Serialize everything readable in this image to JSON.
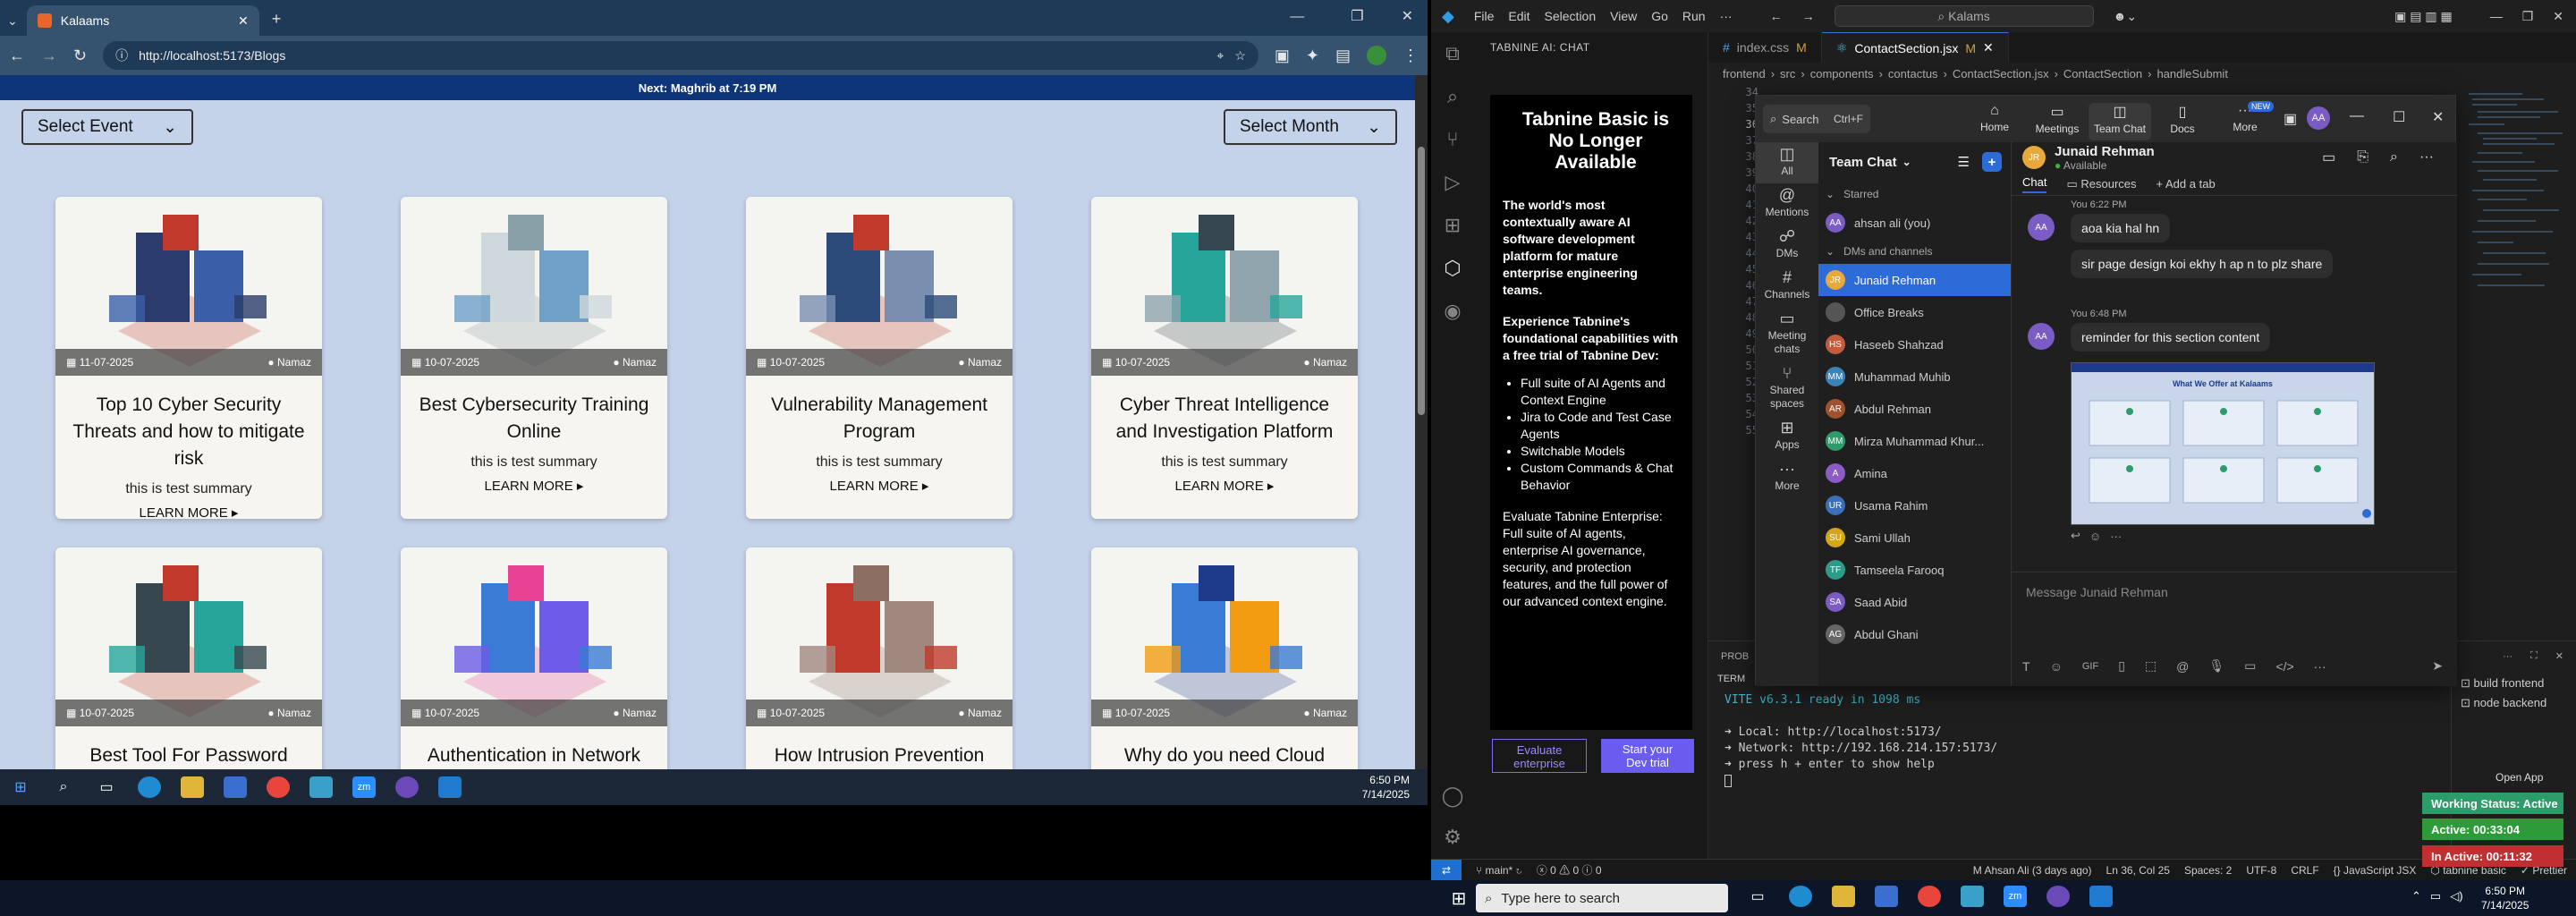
{
  "browser": {
    "tab_title": "Kalaams",
    "url": "http://localhost:5173/Blogs",
    "prayer_banner_prefix": "Next:",
    "prayer_banner": "Maghrib at 7:19 PM",
    "select_event": "Select Event",
    "select_month": "Select Month",
    "cards": [
      {
        "date": "11-07-2025",
        "tag": "Namaz",
        "title": "Top 10 Cyber Security Threats and how to mitigate risk",
        "summary": "this is test summary",
        "more": "LEARN MORE"
      },
      {
        "date": "10-07-2025",
        "tag": "Namaz",
        "title": "Best Cybersecurity Training Online",
        "summary": "this is test summary",
        "more": "LEARN MORE"
      },
      {
        "date": "10-07-2025",
        "tag": "Namaz",
        "title": "Vulnerability Management Program",
        "summary": "this is test summary",
        "more": "LEARN MORE"
      },
      {
        "date": "10-07-2025",
        "tag": "Namaz",
        "title": "Cyber Threat Intelligence and Investigation Platform",
        "summary": "this is test summary",
        "more": "LEARN MORE"
      },
      {
        "date": "10-07-2025",
        "tag": "Namaz",
        "title": "Best Tool For Password",
        "summary": "",
        "more": ""
      },
      {
        "date": "10-07-2025",
        "tag": "Namaz",
        "title": "Authentication in Network",
        "summary": "",
        "more": ""
      },
      {
        "date": "10-07-2025",
        "tag": "Namaz",
        "title": "How Intrusion Prevention",
        "summary": "",
        "more": ""
      },
      {
        "date": "10-07-2025",
        "tag": "Namaz",
        "title": "Why do you need Cloud",
        "summary": "",
        "more": ""
      }
    ],
    "taskbar_time": "6:50 PM",
    "taskbar_date": "7/14/2025"
  },
  "vscode": {
    "menu": [
      "File",
      "Edit",
      "Selection",
      "View",
      "Go",
      "Run",
      "···"
    ],
    "search": "Kalams",
    "tabnine": {
      "header": "TABNINE AI: CHAT",
      "title": "Tabnine Basic is No Longer Available",
      "p1": "The world's most contextually aware AI software development platform for mature enterprise engineering teams.",
      "p2": "Experience Tabnine's foundational capabilities with a free trial of Tabnine Dev:",
      "bullets": [
        "Full suite of AI Agents and Context Engine",
        "Jira to Code and Test Case Agents",
        "Switchable Models",
        "Custom Commands & Chat Behavior"
      ],
      "p3": "Evaluate Tabnine Enterprise: Full suite of AI agents, enterprise AI governance, security, and protection features, and the full power of our advanced context engine.",
      "btn_eval": "Evaluate enterprise",
      "btn_trial": "Start your Dev trial"
    },
    "tabs": [
      {
        "name": "index.css",
        "mark": "M"
      },
      {
        "name": "ContactSection.jsx",
        "mark": "M"
      }
    ],
    "breadcrumb": [
      "frontend",
      "src",
      "components",
      "contactus",
      "ContactSection.jsx",
      "ContactSection",
      "handleSubmit"
    ],
    "line_numbers": [
      "34",
      "35",
      "36",
      "37",
      "38",
      "39",
      "40",
      "41",
      "42",
      "43",
      "44",
      "45",
      "46",
      "47",
      "48",
      "49",
      "50",
      "51",
      "52",
      "53",
      "54",
      "55"
    ],
    "panel_tab": "PROB",
    "panel_label": "TERM",
    "terminal": [
      "VITE v6.3.1  ready in 1098 ms",
      "",
      "➜  Local:   http://localhost:5173/",
      "➜  Network: http://192.168.214.157:5173/",
      "➜  press h + enter to show help"
    ],
    "terminal_side": [
      "build frontend",
      "node backend"
    ],
    "status": {
      "branch": "main*",
      "errors": "0",
      "warnings": "0",
      "info": "0",
      "blame": "M Ahsan Ali (3 days ago)",
      "pos": "Ln 36, Col 25",
      "spaces": "Spaces: 2",
      "enc": "UTF-8",
      "eol": "CRLF",
      "lang": "JavaScript JSX",
      "tabnine": "tabnine basic",
      "prettier": "Prettier"
    },
    "open_app": "Open App",
    "working_status": "Working Status: Active",
    "active": "Active: 00:33:04",
    "inactive": "In Active: 00:11:32"
  },
  "zoom": {
    "search": "Search",
    "search_shortcut": "Ctrl+F",
    "nav": [
      "Home",
      "Meetings",
      "Team Chat",
      "Docs",
      "More"
    ],
    "new_badge": "NEW",
    "avatar": "AA",
    "rail": [
      "All",
      "Mentions",
      "DMs",
      "Channels",
      "Meeting chats",
      "Shared spaces",
      "Apps",
      "More"
    ],
    "list_title": "Team Chat",
    "starred": "Starred",
    "dms": "DMs and channels",
    "contacts": [
      {
        "name": "ahsan ali (you)",
        "ini": "AA",
        "color": "#7b5cc4"
      },
      {
        "name": "Junaid Rehman",
        "ini": "JR",
        "color": "#e8a93b"
      },
      {
        "name": "Office Breaks",
        "ini": "",
        "color": "#555"
      },
      {
        "name": "Haseeb Shahzad",
        "ini": "HS",
        "color": "#c45c3c"
      },
      {
        "name": "Muhammad Muhib",
        "ini": "MM",
        "color": "#3b82b8"
      },
      {
        "name": "Abdul Rehman",
        "ini": "AR",
        "color": "#a0522d"
      },
      {
        "name": "Mirza Muhammad Khur...",
        "ini": "MM",
        "color": "#2e9b6a"
      },
      {
        "name": "Amina",
        "ini": "A",
        "color": "#8a5cc4"
      },
      {
        "name": "Usama Rahim",
        "ini": "UR",
        "color": "#3b6fb8"
      },
      {
        "name": "Sami Ullah",
        "ini": "SU",
        "color": "#d4a51c"
      },
      {
        "name": "Tamseela Farooq",
        "ini": "TF",
        "color": "#2e9b8a"
      },
      {
        "name": "Saad Abid",
        "ini": "SA",
        "color": "#7b5cc4"
      },
      {
        "name": "Abdul Ghani",
        "ini": "AG",
        "color": "#666"
      }
    ],
    "chat_name": "Junaid Rehman",
    "chat_status": "Available",
    "chat_tabs": [
      "Chat",
      "Resources",
      "Add a tab"
    ],
    "messages": [
      {
        "time": "You 6:22 PM",
        "text": "aoa kia hal hn"
      },
      {
        "time": "",
        "text": "sir page design koi ekhy h ap n to plz share"
      },
      {
        "time": "You 6:48 PM",
        "text": "reminder for this section content"
      }
    ],
    "shot_title": "What We Offer at Kalaams",
    "composer": "Message Junaid Rehman",
    "gif": "GIF"
  },
  "taskbar": {
    "search": "Type here to search",
    "time": "6:50 PM",
    "date": "7/14/2025"
  }
}
